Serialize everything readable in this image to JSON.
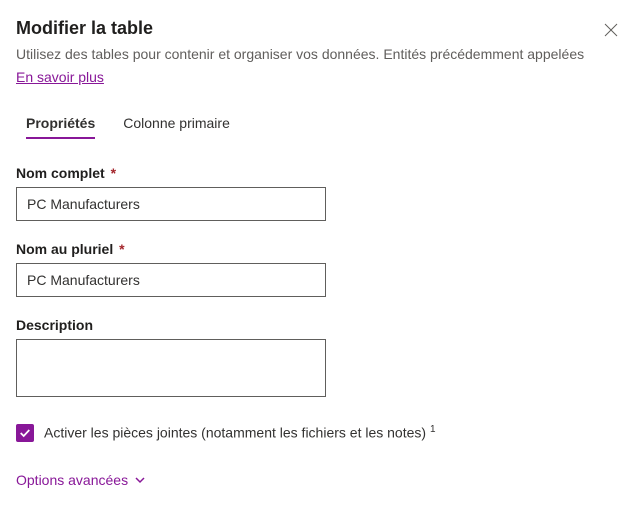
{
  "header": {
    "title": "Modifier la table",
    "subtitle": "Utilisez des tables pour contenir et organiser vos données. Entités précédemment appelées",
    "learn_more": "En savoir plus"
  },
  "tabs": {
    "properties": "Propriétés",
    "primary_column": "Colonne primaire"
  },
  "fields": {
    "display_name": {
      "label": "Nom complet",
      "value": "PC Manufacturers"
    },
    "plural_name": {
      "label": "Nom au pluriel",
      "value": "PC Manufacturers"
    },
    "description": {
      "label": "Description",
      "value": ""
    },
    "attachments": {
      "label": "Activer les pièces jointes (notamment les fichiers et les notes)",
      "checked": true
    }
  },
  "advanced_options": "Options avancées"
}
